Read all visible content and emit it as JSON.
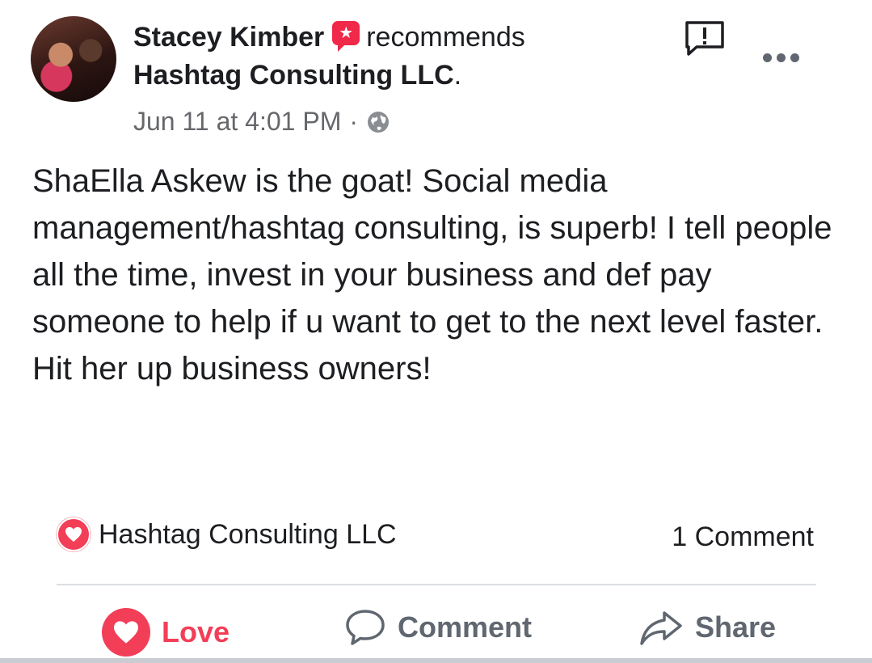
{
  "post": {
    "author": "Stacey Kimber",
    "action": "recommends",
    "page_name": "Hashtag Consulting LLC",
    "page_suffix": ".",
    "timestamp": "Jun 11 at 4:01 PM",
    "separator": "·",
    "text": "ShaElla Askew is the goat! Social media management/hashtag consulting, is superb! I tell people all the time, invest in your business and def pay someone to help if u want to get to the next level faster. Hit her up business owners!"
  },
  "reactions": {
    "reactor": "Hashtag Consulting LLC",
    "icon": "heart-icon",
    "comments": "1 Comment"
  },
  "actions": {
    "love": "Love",
    "comment": "Comment",
    "share": "Share"
  },
  "colors": {
    "love_red": "#f33e58",
    "recommend_badge": "#f02849",
    "secondary_text": "#65676b"
  }
}
